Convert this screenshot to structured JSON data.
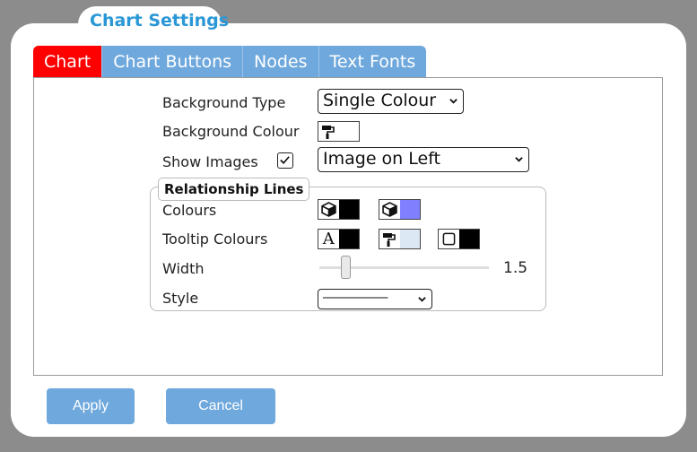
{
  "dialog": {
    "title": "Chart Settings"
  },
  "tabs": [
    {
      "label": "Chart",
      "active": true
    },
    {
      "label": "Chart Buttons",
      "active": false
    },
    {
      "label": "Nodes",
      "active": false
    },
    {
      "label": "Text Fonts",
      "active": false
    }
  ],
  "chart": {
    "background_type": {
      "label": "Background Type",
      "value": "Single Colour"
    },
    "background_colour": {
      "label": "Background Colour",
      "color": "#ffffff",
      "icon": "paint-roller-icon"
    },
    "show_images": {
      "label": "Show Images",
      "checked": true,
      "value": "Image on Left"
    }
  },
  "relationship_lines": {
    "title": "Relationship Lines",
    "colours": {
      "label": "Colours",
      "swatches": [
        {
          "icon": "cube-icon",
          "color": "#000000"
        },
        {
          "icon": "cube-icon",
          "color": "#8080ff"
        }
      ]
    },
    "tooltip_colours": {
      "label": "Tooltip Colours",
      "swatches": [
        {
          "icon": "text-color-icon",
          "color": "#000000"
        },
        {
          "icon": "paint-roller-icon",
          "color": "#dce8f4"
        },
        {
          "icon": "border-icon",
          "color": "#000000"
        }
      ]
    },
    "width": {
      "label": "Width",
      "value": "1.5"
    },
    "style": {
      "label": "Style",
      "value": "──────────"
    }
  },
  "buttons": {
    "apply": "Apply",
    "cancel": "Cancel"
  },
  "colors": {
    "accent": "#6fa8dc",
    "active_tab": "#ff0000",
    "title": "#2a97d6"
  }
}
